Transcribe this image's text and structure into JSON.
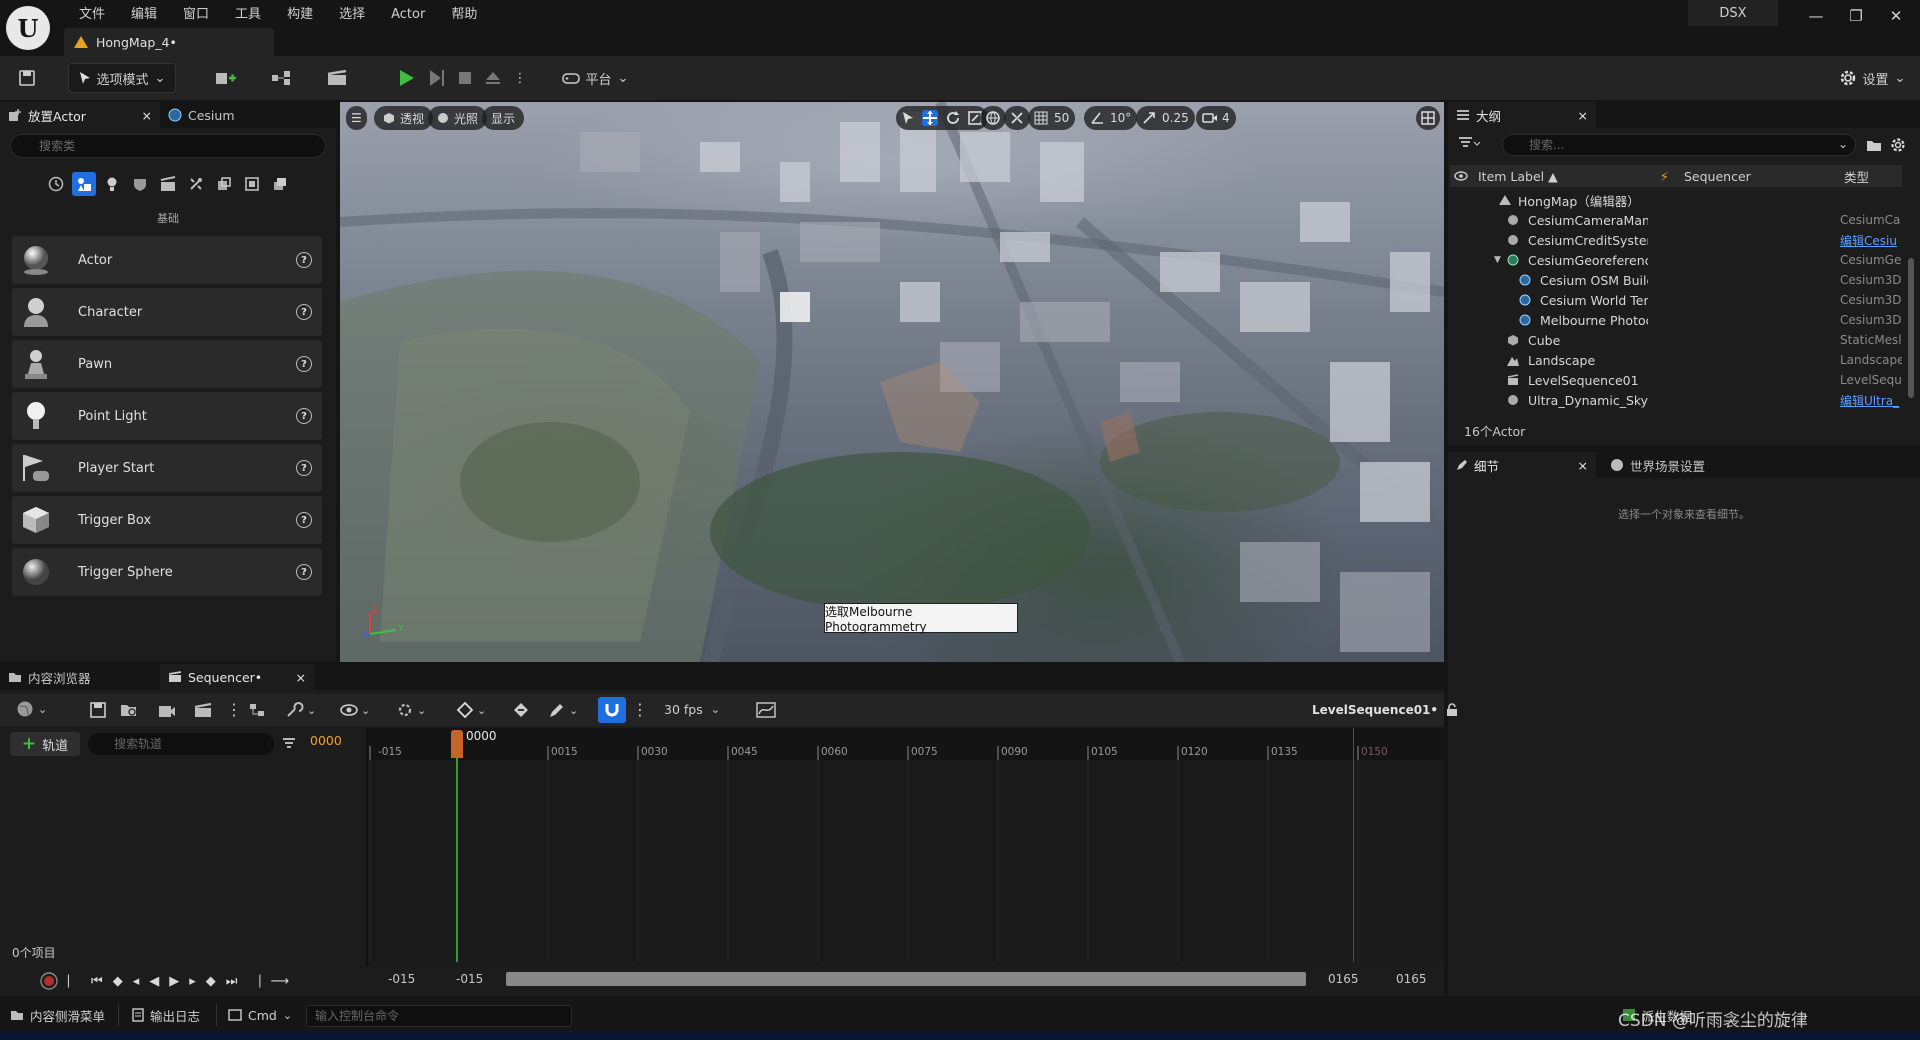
{
  "app": {
    "logo_text": "U",
    "menu": [
      "文件",
      "编辑",
      "窗口",
      "工具",
      "构建",
      "选择",
      "Actor",
      "帮助"
    ],
    "document_tab": "HongMap_4•",
    "user_badge": "DSX",
    "window_controls": {
      "minimize": "—",
      "restore": "❐",
      "close": "✕"
    }
  },
  "toolbar": {
    "mode_label": "选项模式",
    "platform_label": "平台",
    "settings_label": "设置"
  },
  "place_actors": {
    "tab_label": "放置Actor",
    "cesium_tab_label": "Cesium",
    "search_placeholder": "搜索类",
    "category_label": "基础",
    "items": [
      {
        "label": "Actor",
        "icon": "sphere-icon"
      },
      {
        "label": "Character",
        "icon": "character-icon"
      },
      {
        "label": "Pawn",
        "icon": "pawn-icon"
      },
      {
        "label": "Point Light",
        "icon": "light-bulb-icon"
      },
      {
        "label": "Player Start",
        "icon": "player-start-icon"
      },
      {
        "label": "Trigger Box",
        "icon": "trigger-box-icon"
      },
      {
        "label": "Trigger Sphere",
        "icon": "trigger-sphere-icon"
      }
    ]
  },
  "viewport": {
    "perspective_label": "透视",
    "lit_label": "光照",
    "show_label": "显示",
    "grid_snap": "50",
    "rotation_snap": "10°",
    "scale_snap": "0.25",
    "camera_speed": "4",
    "tooltip": "选取Melbourne Photogrammetry",
    "axis_labels": {
      "z": "Z",
      "x": "X",
      "y": "Y"
    }
  },
  "outliner": {
    "tab_label": "大纲",
    "search_placeholder": "搜索...",
    "columns": {
      "label": "Item Label ▲",
      "sequencer": "Sequencer",
      "type": "类型"
    },
    "rows": [
      {
        "label": "HongMap（编辑器）",
        "type": "",
        "link": false,
        "indent": 0
      },
      {
        "label": "CesiumCameraMan",
        "type": "CesiumCa",
        "link": false,
        "indent": 1
      },
      {
        "label": "CesiumCreditSyster",
        "type": "编辑Cesiu",
        "link": true,
        "indent": 1
      },
      {
        "label": "CesiumGeoreferenc",
        "type": "CesiumGe",
        "link": false,
        "indent": 1
      },
      {
        "label": "Cesium OSM Builc",
        "type": "Cesium3D",
        "link": false,
        "indent": 2
      },
      {
        "label": "Cesium World Ter",
        "type": "Cesium3D",
        "link": false,
        "indent": 2
      },
      {
        "label": "Melbourne Photoc",
        "type": "Cesium3D",
        "link": false,
        "indent": 2
      },
      {
        "label": "Cube",
        "type": "StaticMesl",
        "link": false,
        "indent": 1
      },
      {
        "label": "Landscape",
        "type": "Landscape",
        "link": false,
        "indent": 1
      },
      {
        "label": "LevelSequence01",
        "type": "LevelSequ",
        "link": false,
        "indent": 1
      },
      {
        "label": "Ultra_Dynamic_Sky",
        "type": "编辑Ultra_",
        "link": true,
        "indent": 1
      }
    ],
    "actor_count": "16个Actor"
  },
  "details": {
    "tab_label": "细节",
    "world_settings_tab": "世界场景设置",
    "empty_message": "选择一个对象来查看细节。"
  },
  "sequencer": {
    "content_browser_tab": "内容浏览器",
    "tab_label": "Sequencer•",
    "fps_label": "30 fps",
    "sequence_name": "LevelSequence01•",
    "add_track_label": "轨道",
    "track_search_placeholder": "搜索轨道",
    "current_frame": "0000",
    "playhead_label": "0000",
    "ruler_ticks": [
      "-015",
      "0015",
      "0030",
      "0045",
      "0060",
      "0075",
      "0090",
      "0105",
      "0120",
      "0135",
      "0150"
    ],
    "items_count": "0个项目",
    "range_start_a": "-015",
    "range_start_b": "-015",
    "range_end_a": "0165",
    "range_end_b": "0165"
  },
  "statusbar": {
    "content_drawer": "内容侧滑菜单",
    "output_log": "输出日志",
    "cmd_label": "Cmd",
    "console_placeholder": "输入控制台命令",
    "derived_data": "派生数据",
    "watermark": "CSDN @听雨衾尘的旋律"
  },
  "colors": {
    "accent": "#1f6fe0",
    "play_green": "#3fbf3f",
    "playhead_orange": "#c86428",
    "link_blue": "#5aa0ff"
  }
}
